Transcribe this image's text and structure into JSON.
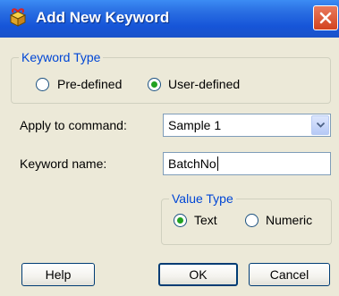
{
  "window": {
    "title": "Add New Keyword",
    "close_label": "×"
  },
  "keyword_type": {
    "legend": "Keyword Type",
    "options": [
      {
        "label": "Pre-defined",
        "selected": false
      },
      {
        "label": "User-defined",
        "selected": true
      }
    ]
  },
  "apply_to_command": {
    "label": "Apply to command:",
    "value": "Sample 1"
  },
  "keyword_name": {
    "label": "Keyword name:",
    "value": "BatchNo"
  },
  "value_type": {
    "legend": "Value Type",
    "options": [
      {
        "label": "Text",
        "selected": true
      },
      {
        "label": "Numeric",
        "selected": false
      }
    ]
  },
  "buttons": {
    "help": "Help",
    "ok": "OK",
    "cancel": "Cancel"
  },
  "colors": {
    "title_bar": "#1655d8",
    "accent_text": "#0046d5",
    "radio_dot": "#21a121",
    "close": "#d2431f"
  },
  "icons": {
    "app": "gift-box-icon",
    "close": "close-icon",
    "dropdown": "chevron-down-icon"
  }
}
